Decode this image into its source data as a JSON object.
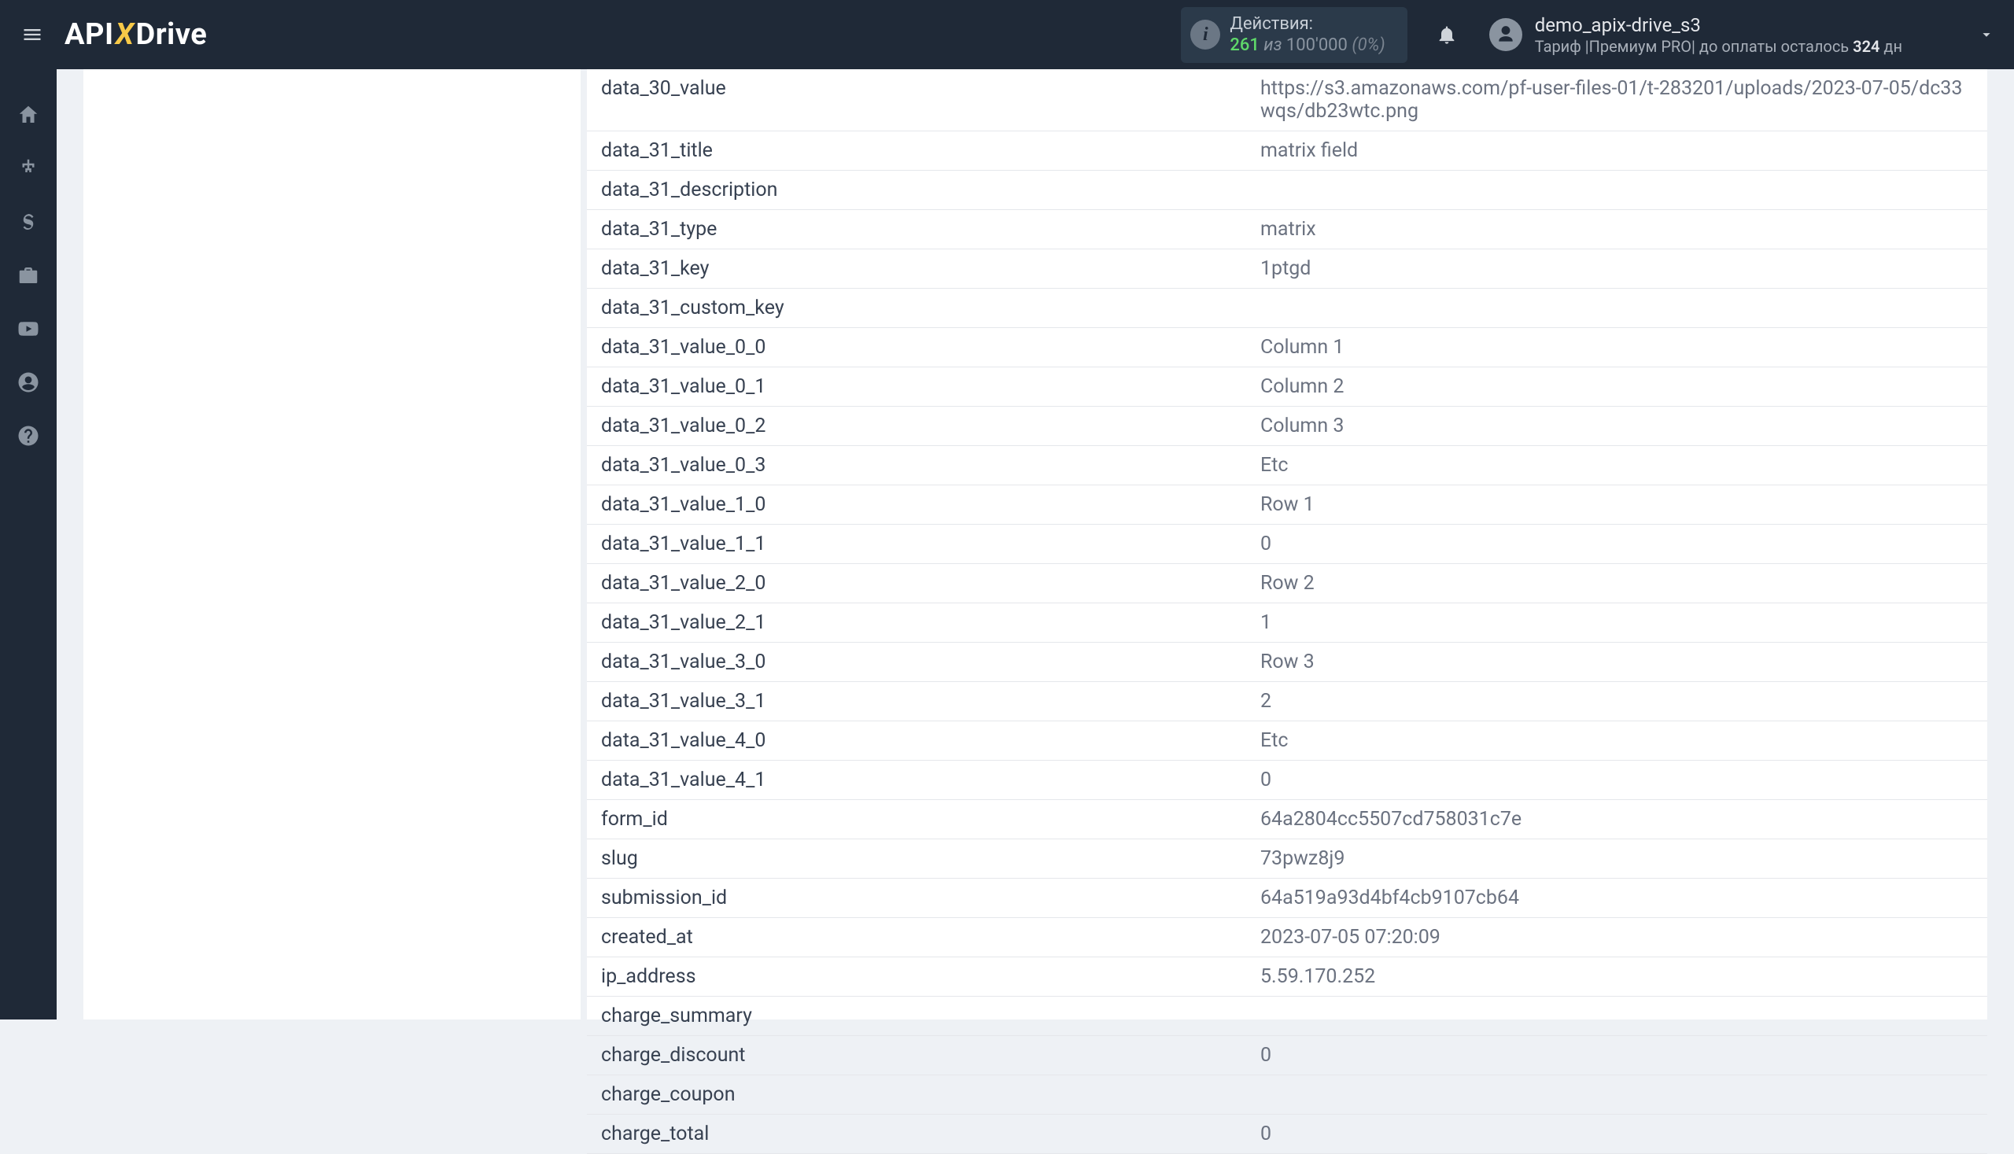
{
  "header": {
    "actions_title": "Действия:",
    "actions_current": "261",
    "actions_iz": "из",
    "actions_total": "100'000",
    "actions_pct": "(0%)",
    "user_name": "demo_apix-drive_s3",
    "tariff_prefix": "Тариф |",
    "tariff_name": "Премиум PRO",
    "tariff_mid": "| до оплаты осталось ",
    "tariff_days": "324",
    "tariff_unit": " дн"
  },
  "rows": [
    {
      "key": "data_30_value",
      "value": "https://s3.amazonaws.com/pf-user-files-01/t-283201/uploads/2023-07-05/dc33wqs/db23wtc.png"
    },
    {
      "key": "data_31_title",
      "value": "matrix field"
    },
    {
      "key": "data_31_description",
      "value": ""
    },
    {
      "key": "data_31_type",
      "value": "matrix"
    },
    {
      "key": "data_31_key",
      "value": "1ptgd"
    },
    {
      "key": "data_31_custom_key",
      "value": ""
    },
    {
      "key": "data_31_value_0_0",
      "value": "Column 1"
    },
    {
      "key": "data_31_value_0_1",
      "value": "Column 2"
    },
    {
      "key": "data_31_value_0_2",
      "value": "Column 3"
    },
    {
      "key": "data_31_value_0_3",
      "value": "Etc"
    },
    {
      "key": "data_31_value_1_0",
      "value": "Row 1"
    },
    {
      "key": "data_31_value_1_1",
      "value": "0"
    },
    {
      "key": "data_31_value_2_0",
      "value": "Row 2"
    },
    {
      "key": "data_31_value_2_1",
      "value": "1"
    },
    {
      "key": "data_31_value_3_0",
      "value": "Row 3"
    },
    {
      "key": "data_31_value_3_1",
      "value": "2"
    },
    {
      "key": "data_31_value_4_0",
      "value": "Etc"
    },
    {
      "key": "data_31_value_4_1",
      "value": "0"
    },
    {
      "key": "form_id",
      "value": "64a2804cc5507cd758031c7e"
    },
    {
      "key": "slug",
      "value": "73pwz8j9"
    },
    {
      "key": "submission_id",
      "value": "64a519a93d4bf4cb9107cb64"
    },
    {
      "key": "created_at",
      "value": "2023-07-05 07:20:09"
    },
    {
      "key": "ip_address",
      "value": "5.59.170.252"
    },
    {
      "key": "charge_summary",
      "value": ""
    },
    {
      "key": "charge_discount",
      "value": "0"
    },
    {
      "key": "charge_coupon",
      "value": ""
    },
    {
      "key": "charge_total",
      "value": "0"
    }
  ]
}
